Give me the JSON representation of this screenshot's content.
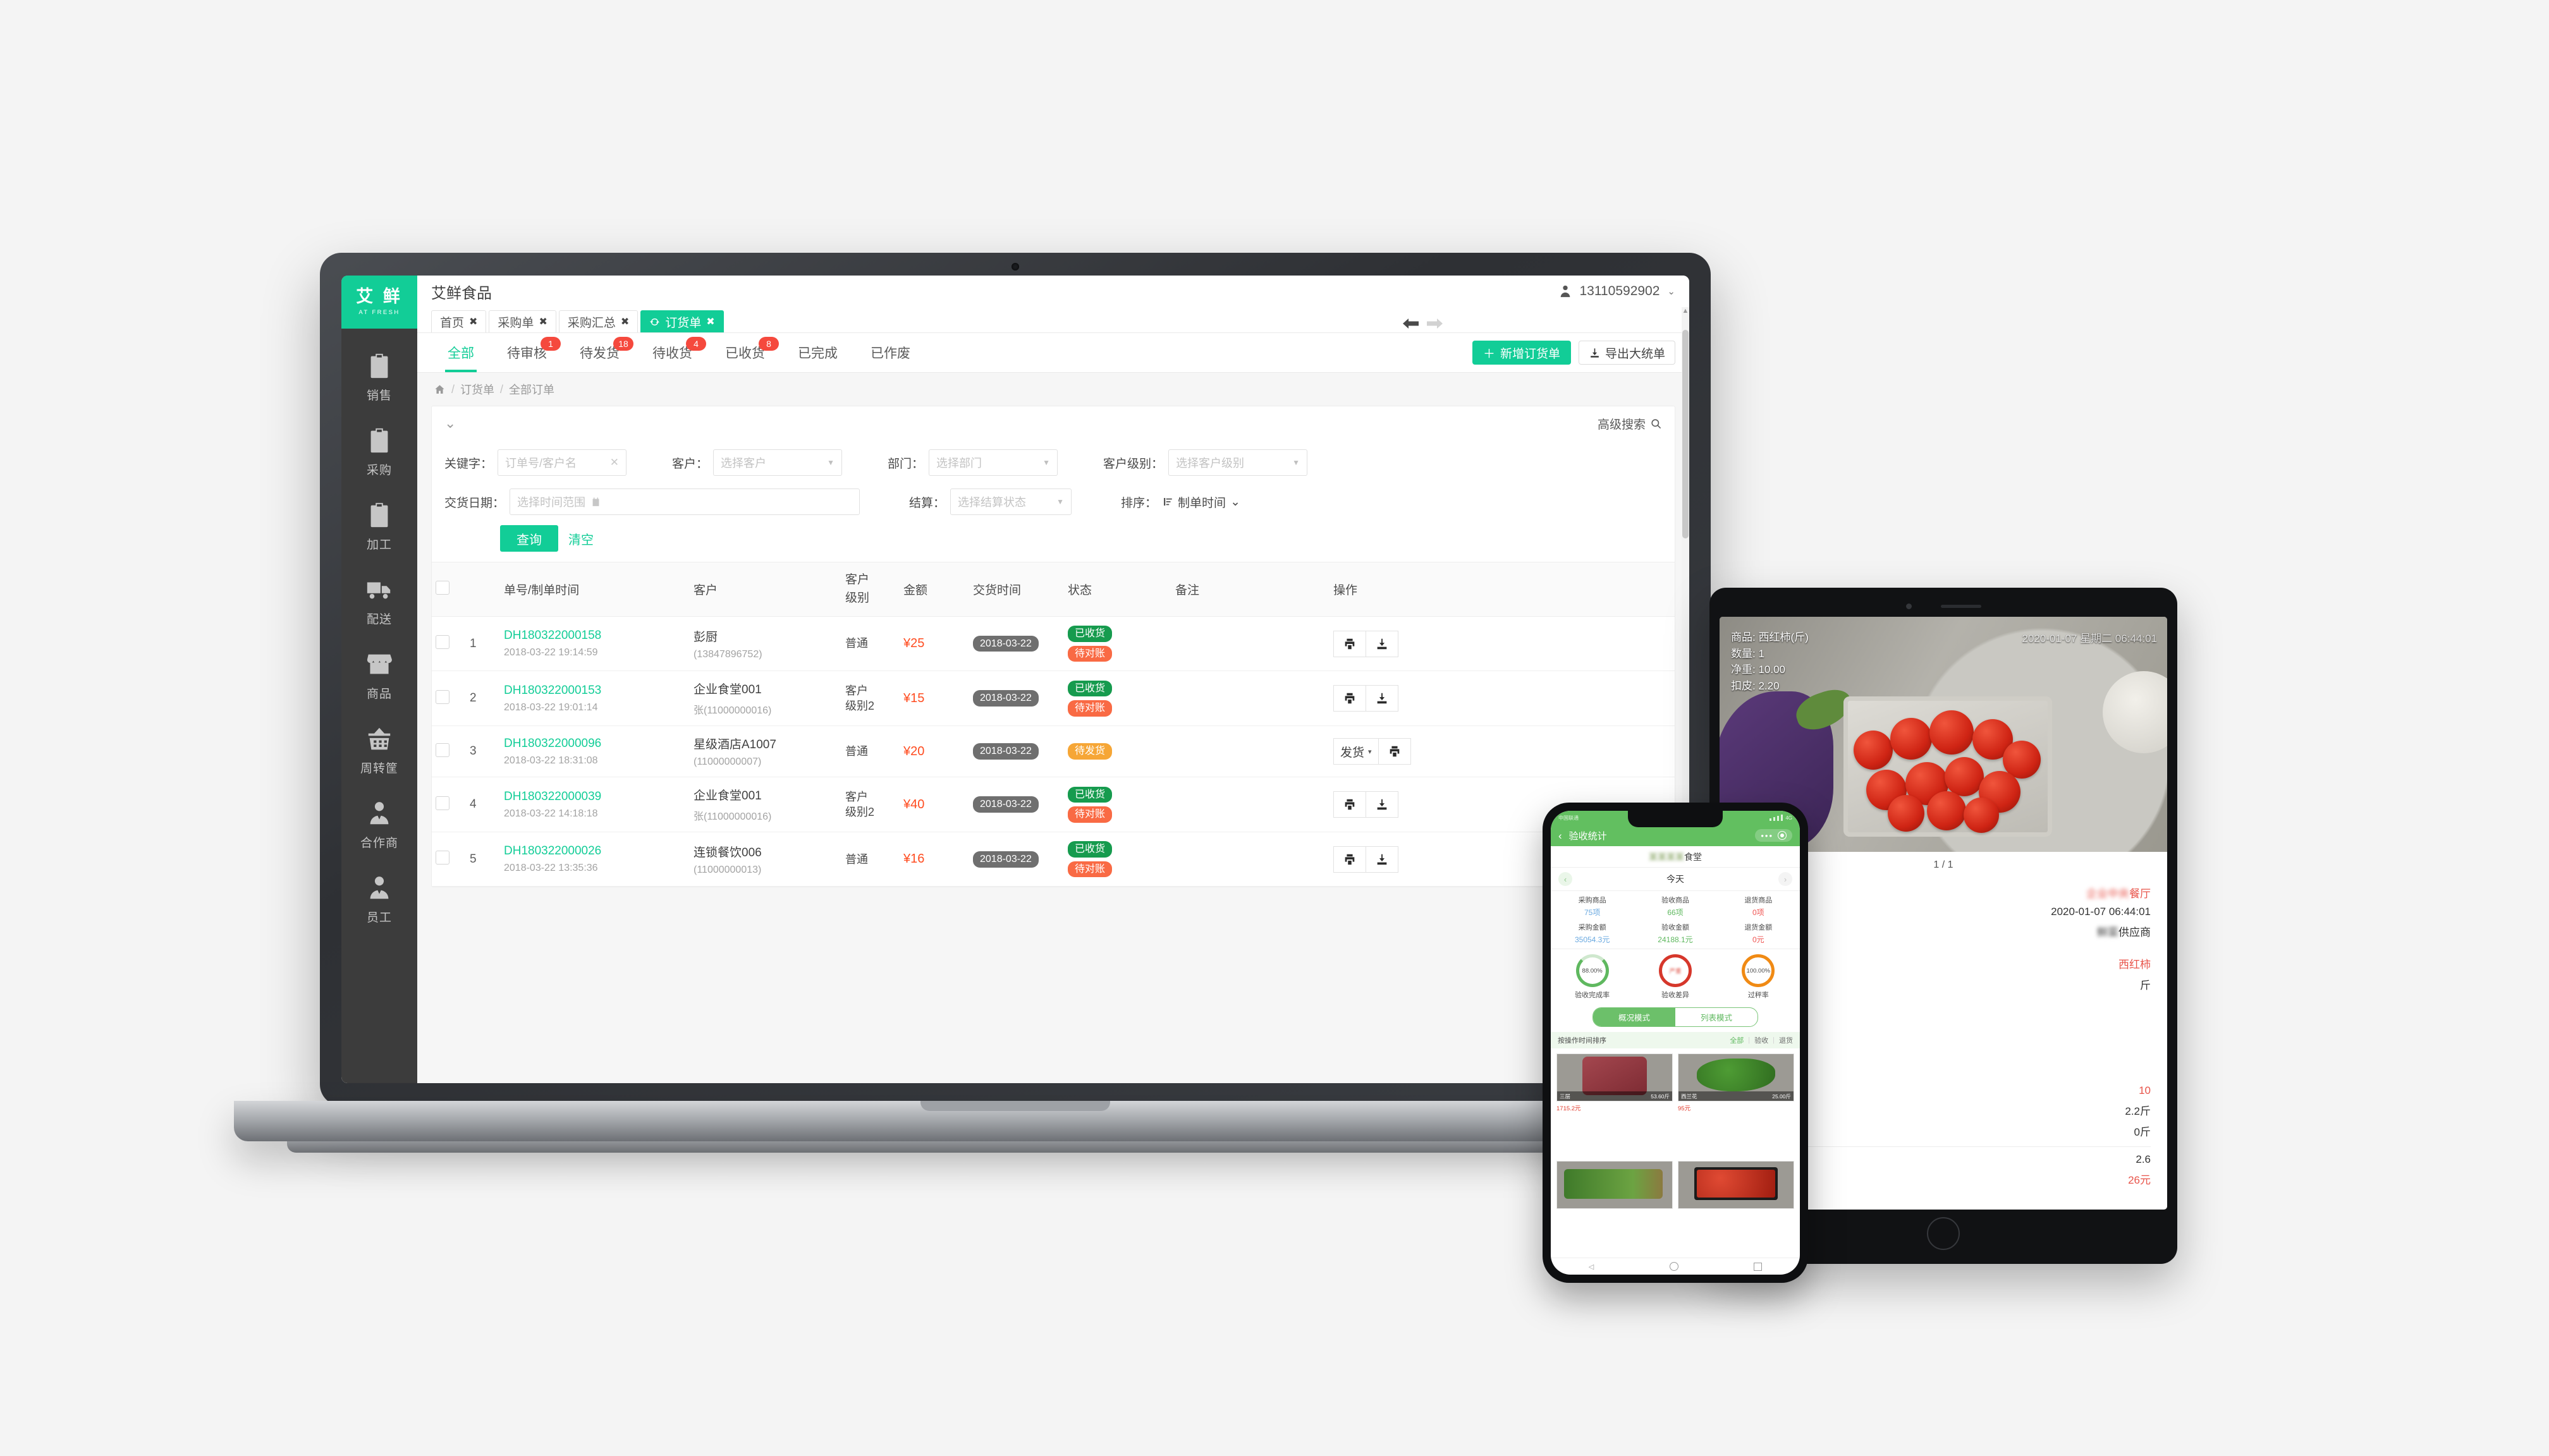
{
  "laptop": {
    "brand": {
      "cn": "艾 鲜",
      "en": "AT FRESH",
      "color": "#12cd97"
    },
    "company": "艾鲜食品",
    "user": {
      "phone": "13110592902",
      "caret": "⌄",
      "icon": "user-icon"
    },
    "nav_arrows": {
      "back": "back-arrow-icon",
      "forward": "forward-arrow-icon"
    },
    "sidebar": {
      "items": [
        {
          "label": "销售",
          "icon": "clipboard-icon"
        },
        {
          "label": "采购",
          "icon": "clipboard-icon"
        },
        {
          "label": "加工",
          "icon": "clipboard-icon"
        },
        {
          "label": "配送",
          "icon": "truck-icon"
        },
        {
          "label": "商品",
          "icon": "store-icon"
        },
        {
          "label": "周转筐",
          "icon": "basket-icon"
        },
        {
          "label": "合作商",
          "icon": "person-tie-icon"
        },
        {
          "label": "员工",
          "icon": "person-tie-icon"
        }
      ]
    },
    "tabs": [
      {
        "label": "首页",
        "close": "✖",
        "active": false
      },
      {
        "label": "采购单",
        "close": "✖",
        "active": false
      },
      {
        "label": "采购汇总",
        "close": "✖",
        "active": false
      },
      {
        "label": "订货单",
        "close": "✖",
        "active": true,
        "icon": "refresh-icon"
      }
    ],
    "status_tabs": [
      {
        "label": "全部",
        "badge": "",
        "active": true
      },
      {
        "label": "待审核",
        "badge": "1",
        "active": false
      },
      {
        "label": "待发货",
        "badge": "18",
        "active": false
      },
      {
        "label": "待收货",
        "badge": "4",
        "active": false
      },
      {
        "label": "已收货",
        "badge": "8",
        "active": false
      },
      {
        "label": "已完成",
        "badge": "",
        "active": false
      },
      {
        "label": "已作废",
        "badge": "",
        "active": false
      }
    ],
    "top_actions": {
      "add_label": "新增订货单",
      "add_plus": "＋",
      "export_label": "导出大统单",
      "export_icon": "download-icon"
    },
    "breadcrumb": {
      "home_icon": "home-icon",
      "sep": "/",
      "items": [
        "订货单",
        "全部订单"
      ]
    },
    "panel": {
      "collapse_icon": "chevron-down-icon",
      "advanced_label": "高级搜索",
      "advanced_icon": "search-icon"
    },
    "filters": {
      "keyword": {
        "label": "关键字：",
        "placeholder": "订单号/客户名",
        "clear": "✕"
      },
      "customer": {
        "label": "客户：",
        "placeholder": "选择客户",
        "caret": "▼"
      },
      "department": {
        "label": "部门：",
        "placeholder": "选择部门",
        "caret": "▼"
      },
      "customer_level": {
        "label": "客户级别：",
        "placeholder": "选择客户级别",
        "caret": "▼"
      },
      "delivery_date": {
        "label": "交货日期：",
        "placeholder": "选择时间范围",
        "icon": "calendar-icon"
      },
      "settlement": {
        "label": "结算：",
        "placeholder": "选择结算状态",
        "caret": "▼"
      },
      "sort": {
        "label": "排序：",
        "value": "制单时间",
        "icon": "sort-icon",
        "caret": "⌄"
      },
      "query_label": "查询",
      "clear_label": "清空"
    },
    "table": {
      "columns": [
        "",
        "",
        "单号/制单时间",
        "客户",
        "客户级别",
        "金额",
        "交货时间",
        "状态",
        "备注",
        "操作"
      ],
      "rows": [
        {
          "index": "1",
          "order_no": "DH180322000158",
          "order_time": "2018-03-22 19:14:59",
          "customer": "彭厨",
          "customer_no": "(13847896752)",
          "level": "普通",
          "amount": "¥25",
          "delivery": "2018-03-22",
          "status": [
            {
              "text": "已收货",
              "tone": "green"
            },
            {
              "text": "待对账",
              "tone": "red"
            }
          ],
          "remark": "",
          "ops": [
            {
              "type": "icon",
              "icon": "printer-icon"
            },
            {
              "type": "icon",
              "icon": "download-icon"
            }
          ]
        },
        {
          "index": "2",
          "order_no": "DH180322000153",
          "order_time": "2018-03-22 19:01:14",
          "customer": "企业食堂001",
          "customer_no": "张(11000000016)",
          "level": "客户\n级别2",
          "amount": "¥15",
          "delivery": "2018-03-22",
          "status": [
            {
              "text": "已收货",
              "tone": "green"
            },
            {
              "text": "待对账",
              "tone": "red"
            }
          ],
          "remark": "",
          "ops": [
            {
              "type": "icon",
              "icon": "printer-icon"
            },
            {
              "type": "icon",
              "icon": "download-icon"
            }
          ]
        },
        {
          "index": "3",
          "order_no": "DH180322000096",
          "order_time": "2018-03-22 18:31:08",
          "customer": "星级酒店A1007",
          "customer_no": "(11000000007)",
          "level": "普通",
          "amount": "¥20",
          "delivery": "2018-03-22",
          "status": [
            {
              "text": "待发货",
              "tone": "orange"
            }
          ],
          "remark": "",
          "ops": [
            {
              "type": "text",
              "label": "发货",
              "caret": "▾"
            },
            {
              "type": "icon",
              "icon": "printer-icon"
            }
          ]
        },
        {
          "index": "4",
          "order_no": "DH180322000039",
          "order_time": "2018-03-22 14:18:18",
          "customer": "企业食堂001",
          "customer_no": "张(11000000016)",
          "level": "客户\n级别2",
          "amount": "¥40",
          "delivery": "2018-03-22",
          "status": [
            {
              "text": "已收货",
              "tone": "green"
            },
            {
              "text": "待对账",
              "tone": "red"
            }
          ],
          "remark": "",
          "ops": [
            {
              "type": "icon",
              "icon": "printer-icon"
            },
            {
              "type": "icon",
              "icon": "download-icon"
            }
          ]
        },
        {
          "index": "5",
          "order_no": "DH180322000026",
          "order_time": "2018-03-22 13:35:36",
          "customer": "连锁餐饮006",
          "customer_no": "(11000000013)",
          "level": "普通",
          "amount": "¥16",
          "delivery": "2018-03-22",
          "status": [
            {
              "text": "已收货",
              "tone": "green"
            },
            {
              "text": "待对账",
              "tone": "red"
            }
          ],
          "remark": "",
          "ops": [
            {
              "type": "icon",
              "icon": "printer-icon"
            },
            {
              "type": "icon",
              "icon": "download-icon"
            }
          ]
        }
      ]
    }
  },
  "tablet": {
    "camera": {
      "product_label": "商品: 西红柿(斤)",
      "qty_label": "数量: 1",
      "net_label": "净重: 10.00",
      "tare_label": "扣皮: 2.20",
      "timestamp": "2020-01-07 星期二 06:44:01"
    },
    "page_count": "1 / 1",
    "receipt": {
      "shop": "餐厅",
      "datetime": "2020-01-07 06:44:01",
      "supplier": "供应商",
      "item": "西红柿",
      "unit": "斤",
      "qty": "10",
      "weight": "2.2斤",
      "returned": "0斤",
      "price": "2.6",
      "total": "26元"
    }
  },
  "phone": {
    "status": {
      "carrier": "中国联通",
      "network": "4G"
    },
    "nav": {
      "back": "‹",
      "title": "验收统计",
      "dots": "•••",
      "target": "target-icon"
    },
    "canteen": "食堂",
    "date_nav": {
      "prev": "‹",
      "next": "›",
      "label": "今天"
    },
    "stats": [
      {
        "key": "采购商品",
        "value": "75项",
        "tone": "blue"
      },
      {
        "key": "验收商品",
        "value": "66项",
        "tone": "green"
      },
      {
        "key": "退货商品",
        "value": "0项",
        "tone": "red"
      },
      {
        "key": "采购金额",
        "value": "35054.3元",
        "tone": "blue"
      },
      {
        "key": "验收金额",
        "value": "24188.1元",
        "tone": "green"
      },
      {
        "key": "退货金额",
        "value": "0元",
        "tone": "red"
      }
    ],
    "rings": [
      {
        "value": "88.00%",
        "label": "验收完成率",
        "tone": "green"
      },
      {
        "value": "严重",
        "label": "验收差异",
        "tone": "red"
      },
      {
        "value": "100.00%",
        "label": "过秤率",
        "tone": "orange"
      }
    ],
    "segments": [
      {
        "label": "概况模式",
        "active": true
      },
      {
        "label": "列表模式",
        "active": false
      }
    ],
    "sortbar": {
      "label": "按操作时间排序",
      "filters": [
        "全部",
        "验收",
        "退货"
      ],
      "active": "全部"
    },
    "cards": [
      {
        "name": "三层",
        "weight": "53.60斤",
        "price": "1715.2元",
        "kind": "meat"
      },
      {
        "name": "西兰花",
        "weight": "25.00斤",
        "price": "95元",
        "kind": "brocc"
      },
      {
        "name": "",
        "weight": "",
        "price": "",
        "kind": "greens"
      },
      {
        "name": "",
        "weight": "",
        "price": "",
        "kind": "cherry"
      }
    ],
    "bottom": {
      "back": "◁",
      "home": "home-icon",
      "recents": "square-icon"
    }
  }
}
